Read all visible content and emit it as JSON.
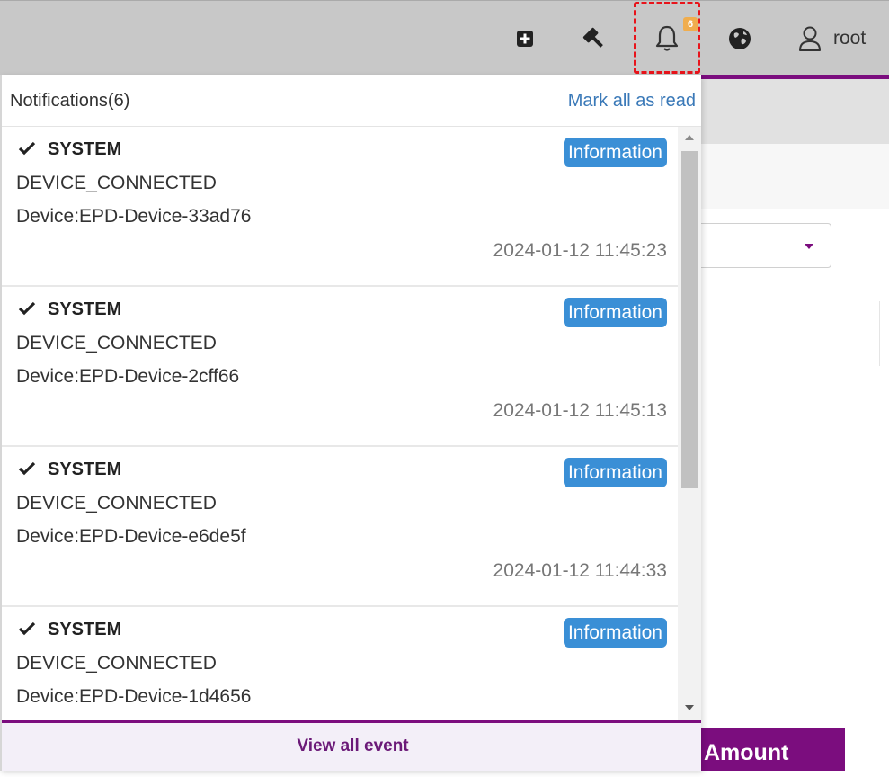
{
  "topbar": {
    "icons": [
      "plus-square-icon",
      "gavel-icon",
      "bell-icon",
      "globe-icon",
      "user-icon"
    ],
    "bell_badge": "6",
    "user_name": "root"
  },
  "background": {
    "amount_header": "Amount"
  },
  "notifications": {
    "title": "Notifications(6)",
    "mark_all_label": "Mark all as read",
    "items": [
      {
        "source": "SYSTEM",
        "level": "Information",
        "event": "DEVICE_CONNECTED",
        "device": "Device:EPD-Device-33ad76",
        "time": "2024-01-12 11:45:23"
      },
      {
        "source": "SYSTEM",
        "level": "Information",
        "event": "DEVICE_CONNECTED",
        "device": "Device:EPD-Device-2cff66",
        "time": "2024-01-12 11:45:13"
      },
      {
        "source": "SYSTEM",
        "level": "Information",
        "event": "DEVICE_CONNECTED",
        "device": "Device:EPD-Device-e6de5f",
        "time": "2024-01-12 11:44:33"
      },
      {
        "source": "SYSTEM",
        "level": "Information",
        "event": "DEVICE_CONNECTED",
        "device": "Device:EPD-Device-1d4656",
        "time": ""
      }
    ],
    "view_all_label": "View all event"
  },
  "colors": {
    "accent_purple": "#7b0d7e",
    "info_badge": "#3a8fd6",
    "link_blue": "#3a79b8",
    "badge_orange": "#f0ad4e",
    "highlight_red": "#e8141b"
  }
}
